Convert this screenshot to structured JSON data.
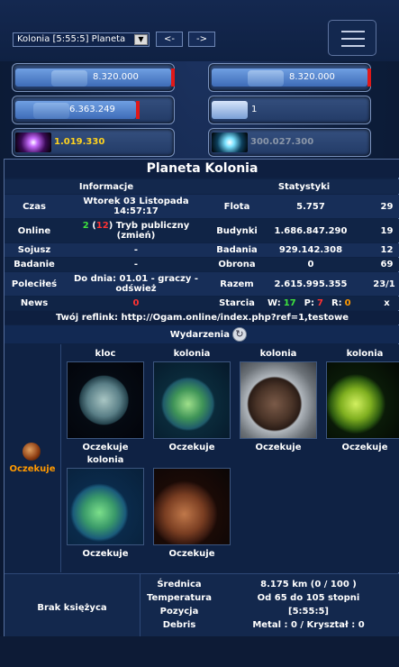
{
  "nav": {
    "planet_select": "Kolonia [5:55:5] Planeta",
    "prev_label": "<-",
    "next_label": "->"
  },
  "resources": {
    "metal": "8.320.000",
    "crystal_max": "8.320.000",
    "deuterium_left": "6.363.249",
    "crystal_count": "1",
    "energy": "1.019.330",
    "dark_matter": "300.027.300"
  },
  "title": "Planeta Kolonia",
  "info": {
    "header_left": "Informacje",
    "header_right": "Statystyki",
    "rows": [
      {
        "label": "Czas",
        "value": "Wtorek 03 Listopada 14:57:17",
        "stat_label": "Flota",
        "stat_value": "5.757",
        "stat_extra": "29"
      },
      {
        "label": "Online",
        "value_green": "2",
        "value_open": " (",
        "value_red": "12",
        "value_close": ") Tryb publiczny (zmień)",
        "stat_label": "Budynki",
        "stat_value": "1.686.847.290",
        "stat_extra": "19"
      },
      {
        "label": "Sojusz",
        "value": "-",
        "stat_label": "Badania",
        "stat_value": "929.142.308",
        "stat_extra": "12"
      },
      {
        "label": "Badanie",
        "value": "-",
        "stat_label": "Obrona",
        "stat_value": "0",
        "stat_extra": "69"
      },
      {
        "label": "Poleciłeś",
        "value": "Do dnia: 01.01 - graczy - odśwież",
        "stat_label": "Razem",
        "stat_value": "2.615.995.355",
        "stat_extra": "23/1"
      },
      {
        "label": "News",
        "value_red": "0",
        "stat_label": "Starcia",
        "w_label": "W:",
        "w_val": "17",
        "p_label": "P:",
        "p_val": "7",
        "r_label": "R:",
        "r_val": "0",
        "x_label": "x"
      }
    ]
  },
  "reflink": "Twój reflink: http://Ogam.online/index.php?ref=1,testowe",
  "events_label": "Wydarzenia",
  "side_status": "Oczekuje",
  "planets": [
    {
      "name": "kloc",
      "status": "Oczekuje"
    },
    {
      "name": "kolonia",
      "status": "Oczekuje"
    },
    {
      "name": "kolonia",
      "status": "Oczekuje"
    },
    {
      "name": "kolonia",
      "status": "Oczekuje"
    },
    {
      "name": "kolonia",
      "status": "Oczekuje"
    },
    {
      "name": "",
      "status": "Oczekuje"
    }
  ],
  "moon": "Brak księżyca",
  "details": {
    "labels": [
      "Średnica",
      "Temperatura",
      "Pozycja",
      "Debris"
    ],
    "values": [
      "8.175 km (0 / 100 )",
      "Od 65 do 105 stopni",
      "[5:55:5]",
      "Metal : 0 / Kryształ : 0"
    ]
  },
  "colors": {
    "accent": "#6f9fe2",
    "green": "#3ee23e",
    "red": "#ff3232",
    "orange": "#ff9900"
  }
}
